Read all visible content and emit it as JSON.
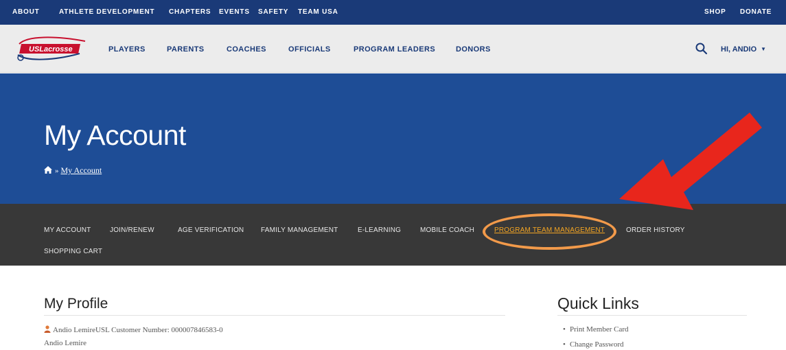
{
  "utility_bar": {
    "left_items": [
      "ABOUT",
      "ATHLETE DEVELOPMENT",
      "CHAPTERS",
      "EVENTS",
      "SAFETY",
      "TEAM USA"
    ],
    "right_items": [
      "SHOP",
      "DONATE"
    ]
  },
  "main_nav": {
    "logo_text": "USLacrosse",
    "items": [
      "PLAYERS",
      "PARENTS",
      "COACHES",
      "OFFICIALS",
      "PROGRAM LEADERS",
      "DONORS"
    ],
    "user_menu_label": "HI, ANDIO"
  },
  "hero": {
    "title": "My Account",
    "breadcrumb_current": "My Account",
    "breadcrumb_separator": "»"
  },
  "account_nav": {
    "items": [
      "MY ACCOUNT",
      "JOIN/RENEW",
      "AGE VERIFICATION",
      "FAMILY MANAGEMENT",
      "E-LEARNING",
      "MOBILE COACH",
      "PROGRAM TEAM MANAGEMENT",
      "ORDER HISTORY",
      "SHOPPING CART"
    ],
    "active_item": "PROGRAM TEAM MANAGEMENT"
  },
  "profile": {
    "title": "My Profile",
    "customer_line": "Andio LemireUSL Customer Number: 000007846583-0",
    "name_line": "Andio Lemire"
  },
  "quick_links": {
    "title": "Quick Links",
    "items": [
      "Print Member Card",
      "Change Password"
    ]
  },
  "icons": {
    "search": "search-icon",
    "home": "home-icon",
    "user": "user-icon",
    "caret": "caret-down-icon",
    "bullet": "•"
  },
  "colors": {
    "utility_bar_bg": "#1a3a78",
    "nav_bg": "#ececec",
    "nav_text": "#1a3a78",
    "hero_bg": "#1e4d96",
    "account_nav_bg": "#383838",
    "account_nav_active": "#f5a623",
    "annotation_ellipse": "#f29a4a",
    "annotation_arrow": "#e8261c"
  }
}
